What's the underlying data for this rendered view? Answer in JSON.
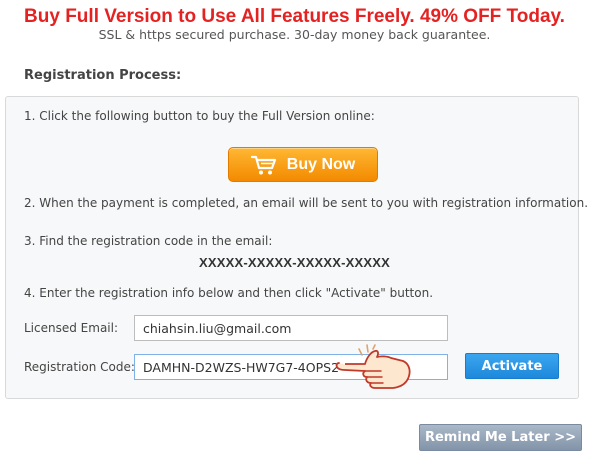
{
  "promo": {
    "title": "Buy Full Version to Use All Features Freely. 49% OFF Today.",
    "subtitle": "SSL & https secured purchase. 30-day money back guarantee."
  },
  "registration": {
    "section_title": "Registration Process:",
    "step1": "1. Click the following button to buy the Full Version online:",
    "buy_button": "Buy Now",
    "step2": "2. When the payment is completed, an email will be sent to you with registration information.",
    "step3": "3. Find the registration code in the email:",
    "code_mask": "XXXXX-XXXXX-XXXXX-XXXXX",
    "step4": "4. Enter the registration info below and then click \"Activate\" button.",
    "email_label": "Licensed Email:",
    "email_value": "chiahsin.liu@gmail.com",
    "code_label": "Registration Code:",
    "code_value": "DAMHN-D2WZS-HW7G7-4OPS2",
    "activate_button": "Activate"
  },
  "footer": {
    "remind_button": "Remind Me Later >>"
  },
  "icons": {
    "buy_icon": "shopping-cart-icon",
    "pointer_icon": "pointing-hand-icon"
  },
  "colors": {
    "promo_red": "#e52222",
    "buy_orange": "#f5a623",
    "activate_blue": "#2b95e6",
    "remind_gray_blue": "#95a5b8"
  }
}
